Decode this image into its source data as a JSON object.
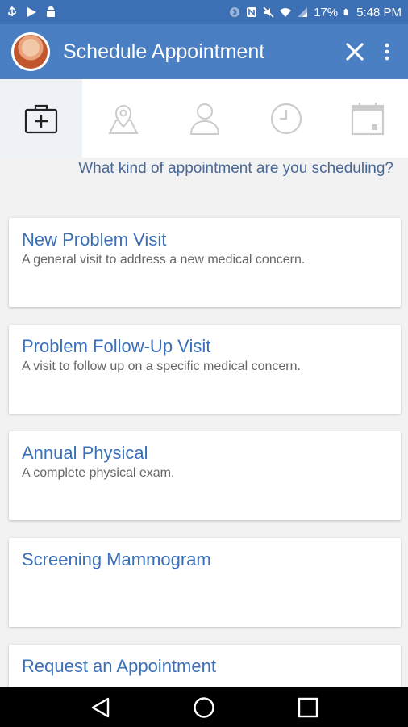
{
  "status_bar": {
    "icons": [
      "usb-icon",
      "play-store-icon",
      "android-debug-icon",
      "bluetooth-icon",
      "nfc-icon",
      "mute-icon",
      "wifi-icon",
      "signal-icon",
      "battery-icon"
    ],
    "battery": "17%",
    "time": "5:48 PM"
  },
  "app_bar": {
    "title": "Schedule Appointment"
  },
  "steps": [
    {
      "icon": "medical-kit-icon",
      "active": true
    },
    {
      "icon": "map-pin-icon",
      "active": false
    },
    {
      "icon": "person-icon",
      "active": false
    },
    {
      "icon": "clock-icon",
      "active": false
    },
    {
      "icon": "calendar-icon",
      "active": false
    }
  ],
  "prompt": "What kind of appointment are you scheduling?",
  "options": [
    {
      "title": "New Problem Visit",
      "description": "A general visit to address a new medical concern."
    },
    {
      "title": "Problem Follow-Up Visit",
      "description": "A visit to follow up on a specific medical concern."
    },
    {
      "title": "Annual Physical",
      "description": "A complete physical exam."
    },
    {
      "title": "Screening Mammogram",
      "description": ""
    },
    {
      "title": "Request an Appointment",
      "description": ""
    }
  ],
  "colors": {
    "status_bar": "#3c6fb4",
    "app_bar": "#4a7fc3",
    "accent_text": "#3a70b9",
    "prompt_text": "#4a6896"
  }
}
